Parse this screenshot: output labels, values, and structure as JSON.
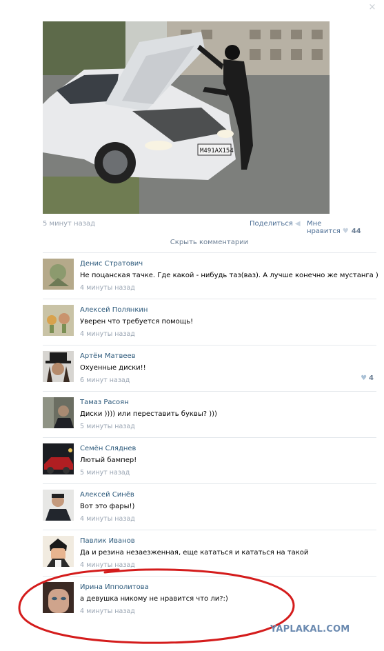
{
  "post": {
    "time": "5 минут назад",
    "share_label": "Поделиться",
    "like_label": "Мне нравится",
    "like_count": "44",
    "hide_comments": "Скрыть комментарии"
  },
  "icons": {
    "close": "×",
    "share": "📢",
    "heart": "♥"
  },
  "colors": {
    "link": "#2b587a",
    "meta": "#9aa5b3",
    "accent": "#4a6c93",
    "highlight": "#d41c1c"
  },
  "comments": [
    {
      "author": "Денис Стратович",
      "text": "Не поцанская тачке. Где какой - нибудь таз(ваз). А лучше конечно же мустанга )",
      "time": "4 минуты назад",
      "likes": ""
    },
    {
      "author": "Алексей Полянкин",
      "text": "Уверен что требуется помощь!",
      "time": "4 минуты назад",
      "likes": ""
    },
    {
      "author": "Артём Матвеев",
      "text": "Охуенные диски!!",
      "time": "6 минут назад",
      "likes": "4"
    },
    {
      "author": "Тамаз Расоян",
      "text": "Диски )))) или переставить буквы? )))",
      "time": "5 минуты назад",
      "likes": ""
    },
    {
      "author": "Семён Сляднев",
      "text": "Лютый бампер!",
      "time": "5 минут назад",
      "likes": ""
    },
    {
      "author": "Алексей Синёв",
      "text": "Вот это фары!)",
      "time": "4 минуты назад",
      "likes": ""
    },
    {
      "author": "Павлик Иванов",
      "text": "Да и резина незаезженная, еще кататься и кататься на такой",
      "time": "4 минуты назад",
      "likes": ""
    },
    {
      "author": "Ирина Ипполитова",
      "text": "а девушка никому не нравится что ли?:)",
      "time": "4 минуты назад",
      "likes": ""
    }
  ],
  "watermark": "YAPLAKAL.COM"
}
